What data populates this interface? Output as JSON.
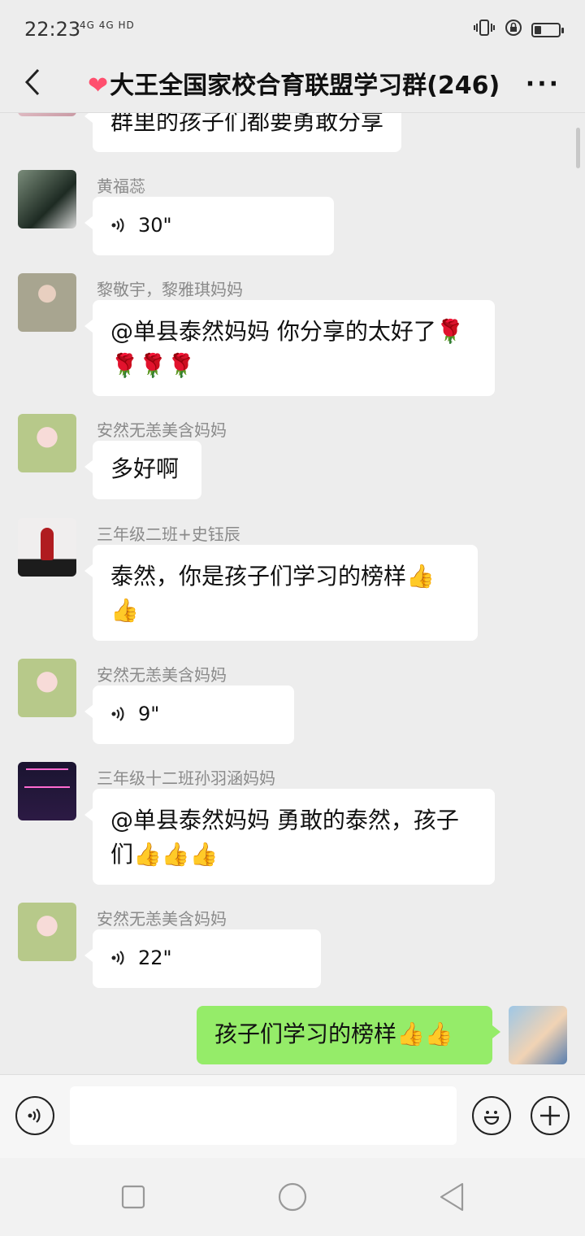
{
  "status_bar": {
    "time": "22:23",
    "signal": "4G 4G HD",
    "icons": [
      "vibrate-icon",
      "rotation-lock-icon",
      "battery-icon"
    ]
  },
  "header": {
    "title": "大王全国家校合育联盟学习群(246)",
    "heart_icon": "❤",
    "more": "···"
  },
  "messages": [
    {
      "sender": "",
      "text": "群里的孩子们都要勇敢分享",
      "type": "text"
    },
    {
      "sender": "黄福蕊",
      "duration": "30\"",
      "type": "voice"
    },
    {
      "sender": "黎敬宇，黎雅琪妈妈",
      "text": "@单县泰然妈妈  你分享的太好了🌹🌹🌹🌹",
      "type": "text"
    },
    {
      "sender": "安然无恙美含妈妈",
      "text": "多好啊",
      "type": "text"
    },
    {
      "sender": "三年级二班+史钰辰",
      "text": "泰然，你是孩子们学习的榜样👍👍",
      "type": "text"
    },
    {
      "sender": "安然无恙美含妈妈",
      "duration": "9\"",
      "type": "voice"
    },
    {
      "sender": "三年级十二班孙羽涵妈妈",
      "text": "@单县泰然妈妈  勇敢的泰然，孩子们👍👍👍",
      "type": "text"
    },
    {
      "sender": "安然无恙美含妈妈",
      "duration": "22\"",
      "type": "voice"
    },
    {
      "sender": "",
      "text": "孩子们学习的榜样👍👍",
      "type": "mine"
    }
  ],
  "input_bar": {
    "placeholder": "",
    "icons": [
      "voice-toggle-icon",
      "emoji-icon",
      "plus-icon"
    ]
  },
  "nav_bar": {
    "icons": [
      "recent-apps-icon",
      "home-icon",
      "back-icon"
    ]
  },
  "colors": {
    "background": "#ededed",
    "own_bubble": "#95ec69",
    "other_bubble": "#ffffff",
    "sender_name": "#8a8a8a"
  }
}
